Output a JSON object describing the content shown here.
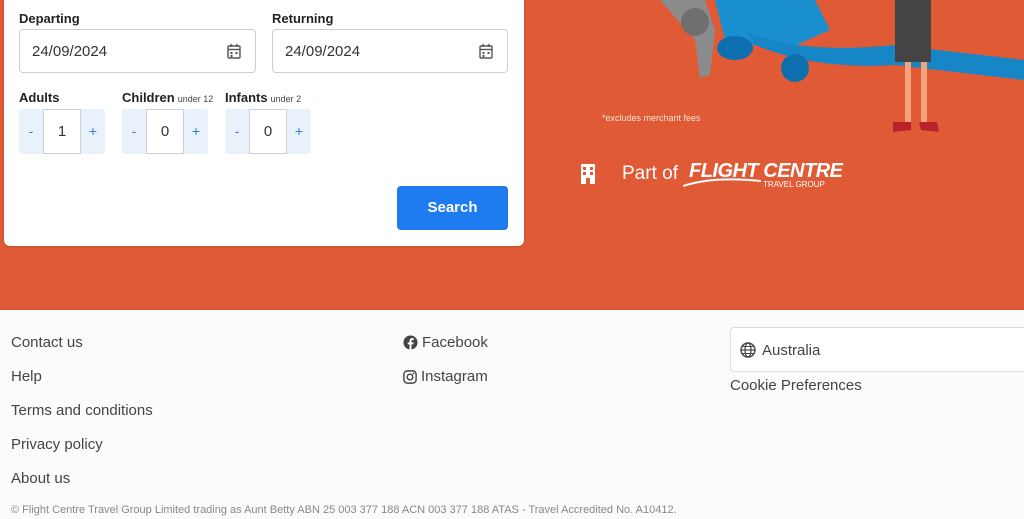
{
  "search_form": {
    "departing_label": "Departing",
    "departing_value": "24/09/2024",
    "returning_label": "Returning",
    "returning_value": "24/09/2024",
    "adults_label": "Adults",
    "children_label": "Children",
    "children_note": "under 12",
    "infants_label": "Infants",
    "infants_note": "under 2",
    "minus": "-",
    "plus": "+",
    "adults_value": "1",
    "children_value": "0",
    "infants_value": "0",
    "search_label": "Search"
  },
  "hero": {
    "excludes_note": "*excludes merchant fees",
    "part_of": "Part of",
    "brand_name": "FLIGHT CENTRE",
    "brand_sub": "TRAVEL GROUP",
    "background_color": "#e05a36"
  },
  "footer": {
    "links": [
      "Contact us",
      "Help",
      "Terms and conditions",
      "Privacy policy",
      "About us"
    ],
    "social": [
      {
        "label": "Facebook",
        "icon": "facebook-icon"
      },
      {
        "label": "Instagram",
        "icon": "instagram-icon"
      }
    ],
    "country": "Australia",
    "cookie_preferences": "Cookie Preferences",
    "copyright": "© Flight Centre Travel Group Limited trading as Aunt Betty ABN 25 003 377 188 ACN 003 377 188 ATAS - Travel Accredited No. A10412."
  },
  "colors": {
    "accent": "#1f7cf0",
    "stepper_bg": "#e9f1fb"
  }
}
